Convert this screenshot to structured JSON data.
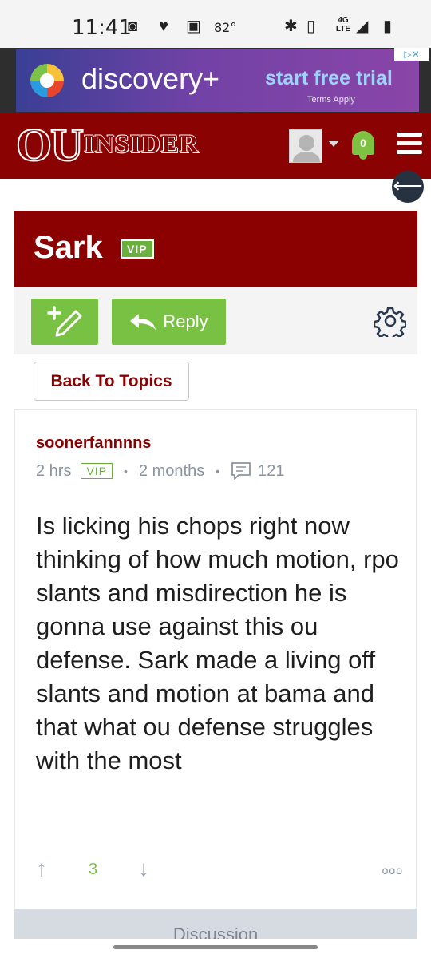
{
  "status_bar": {
    "time": "11:41",
    "temperature": "82°",
    "network": "4G LTE"
  },
  "ad": {
    "brand": "discovery+",
    "cta": "start free trial",
    "terms": "Terms Apply",
    "ad_choice": "▷✕"
  },
  "header": {
    "logo_ou": "OU",
    "logo_insider": "INSIDER",
    "notification_count": "0"
  },
  "topic": {
    "title": "Sark",
    "badge": "VIP"
  },
  "actions": {
    "reply_label": "Reply",
    "back_label": "Back To Topics"
  },
  "post": {
    "author": "soonerfannnns",
    "time_ago": "2 hrs",
    "badge": "VIP",
    "member_for": "2 months",
    "post_count": "121",
    "body": "Is licking his chops right now thinking of how much motion, rpo slants and misdirection he is gonna use against this ou defense. Sark made a living off slants and motion at bama and that what ou defense struggles with the most",
    "votes": "3",
    "more_label": "ooo"
  },
  "discussion": {
    "label": "Discussion"
  },
  "colors": {
    "brand_red": "#8b0202",
    "action_green": "#79c143",
    "ad_purple": "#7242a6"
  }
}
